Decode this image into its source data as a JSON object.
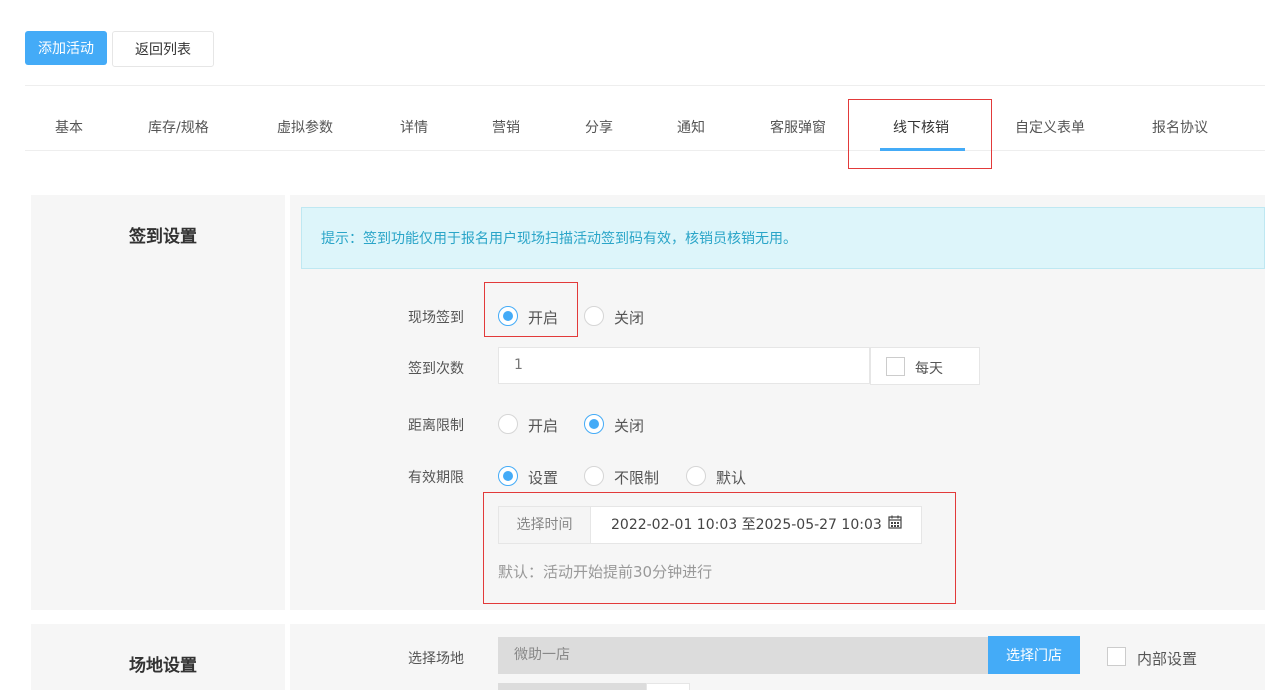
{
  "toolbar": {
    "add_label": "添加活动",
    "back_label": "返回列表"
  },
  "tabs": [
    {
      "label": "基本"
    },
    {
      "label": "库存/规格"
    },
    {
      "label": "虚拟参数"
    },
    {
      "label": "详情"
    },
    {
      "label": "营销"
    },
    {
      "label": "分享"
    },
    {
      "label": "通知"
    },
    {
      "label": "客服弹窗"
    },
    {
      "label": "线下核销",
      "active": true
    },
    {
      "label": "自定义表单"
    },
    {
      "label": "报名协议"
    }
  ],
  "checkin": {
    "title": "签到设置",
    "hint": "提示：签到功能仅用于报名用户现场扫描活动签到码有效，核销员核销无用。",
    "onsite": {
      "label": "现场签到",
      "opt_on": "开启",
      "opt_off": "关闭",
      "selected": "开启"
    },
    "count": {
      "label": "签到次数",
      "value": "1",
      "daily_label": "每天"
    },
    "distance": {
      "label": "距离限制",
      "opt_on": "开启",
      "opt_off": "关闭",
      "selected": "关闭"
    },
    "validity": {
      "label": "有效期限",
      "opt_set": "设置",
      "opt_unlimited": "不限制",
      "opt_default": "默认",
      "selected": "设置"
    },
    "time": {
      "addon": "选择时间",
      "range": "2022-02-01 10:03 至2025-05-27 10:03"
    },
    "default_note": "默认：活动开始提前30分钟进行"
  },
  "venue": {
    "title": "场地设置",
    "label": "选择场地",
    "store_value": "微助一店",
    "store_button": "选择门店",
    "internal_label": "内部设置"
  },
  "colors": {
    "accent": "#44abf7",
    "highlight_box": "#e23a3a",
    "hint_text": "#2aa5c8"
  }
}
